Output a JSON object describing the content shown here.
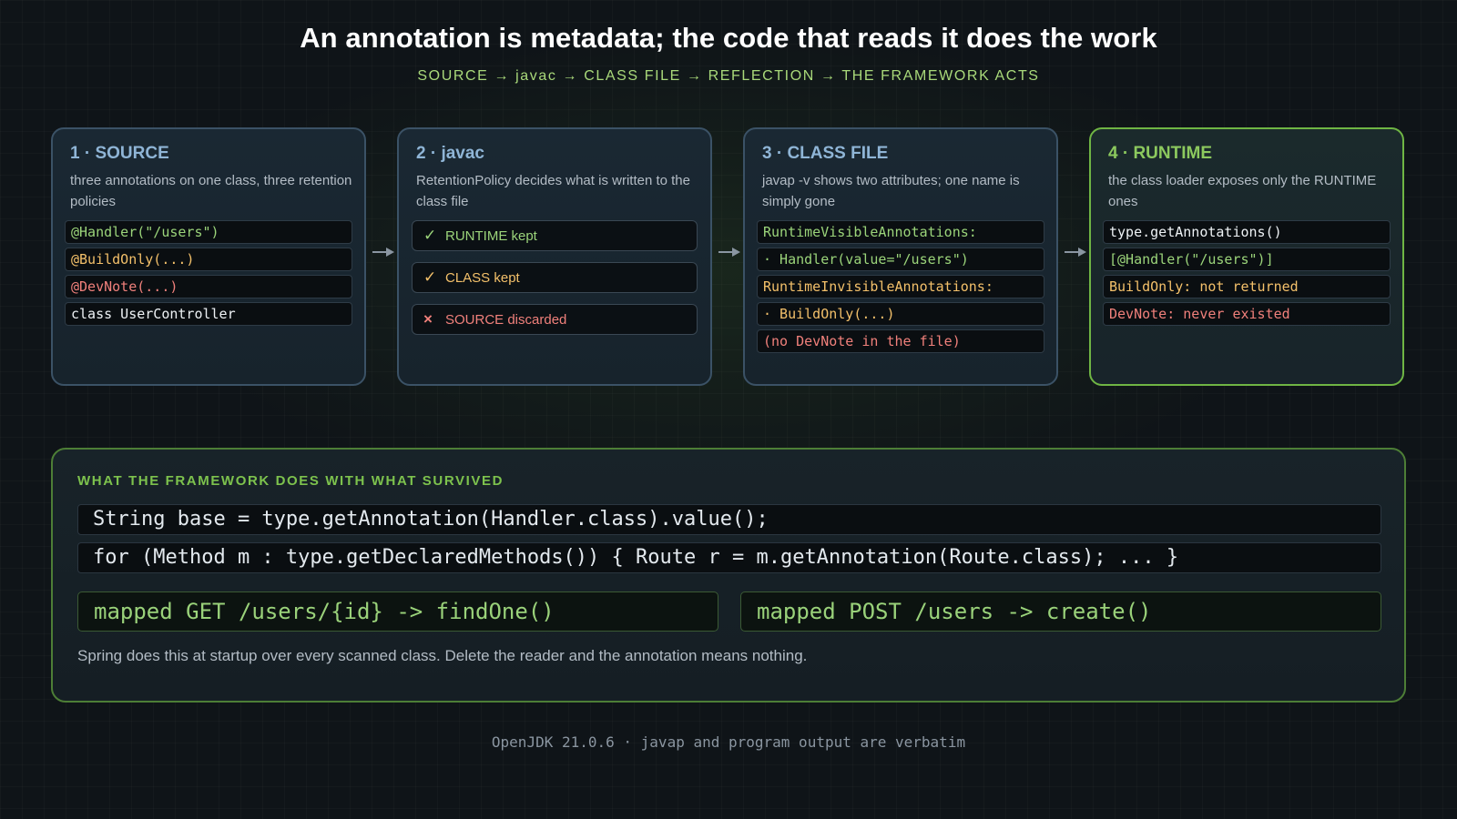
{
  "title": "An annotation is metadata; the code that reads it does the work",
  "subtitle": "SOURCE → javac → CLASS FILE → REFLECTION → THE FRAMEWORK ACTS",
  "colors": {
    "accent_green": "#7dc24d",
    "stage_blue": "#8fb5d6",
    "kept": "#9bd47a",
    "class_only": "#f3c06a",
    "discarded": "#f0807b"
  },
  "stages": [
    {
      "title": "1 · SOURCE",
      "desc": "three annotations on one class, three retention policies",
      "lines": [
        "@Handler(\"/users\")",
        "@BuildOnly(...)",
        "@DevNote(...)",
        "class UserController"
      ]
    },
    {
      "title": "2 · javac",
      "desc": "RetentionPolicy decides what is written to the class file",
      "pills": [
        {
          "icon": "check-icon",
          "mark": "✓",
          "label": "RUNTIME kept"
        },
        {
          "icon": "check-icon",
          "mark": "✓",
          "label": "CLASS kept"
        },
        {
          "icon": "cross-icon",
          "mark": "×",
          "label": "SOURCE discarded"
        }
      ]
    },
    {
      "title": "3 · CLASS FILE",
      "desc": "javap -v shows two attributes; one name is simply gone",
      "lines": [
        "RuntimeVisibleAnnotations:",
        "· Handler(value=\"/users\")",
        "RuntimeInvisibleAnnotations:",
        "· BuildOnly(...)",
        "(no DevNote in the file)"
      ]
    },
    {
      "title": "4 · RUNTIME",
      "desc": "the class loader exposes only the RUNTIME ones",
      "lines": [
        "type.getAnnotations()",
        "[@Handler(\"/users\")]",
        "BuildOnly: not returned",
        "DevNote: never existed"
      ]
    }
  ],
  "framework": {
    "label": "WHAT THE FRAMEWORK DOES WITH WHAT SURVIVED",
    "code": [
      "String base = type.getAnnotation(Handler.class).value();",
      "for (Method m : type.getDeclaredMethods()) { Route r = m.getAnnotation(Route.class); ... }"
    ],
    "mappings": [
      "mapped GET /users/{id} -> findOne()",
      "mapped POST /users -> create()"
    ],
    "note": "Spring does this at startup over every scanned class. Delete the reader and the annotation means nothing."
  },
  "footer": "OpenJDK 21.0.6 · javap and program output are verbatim"
}
